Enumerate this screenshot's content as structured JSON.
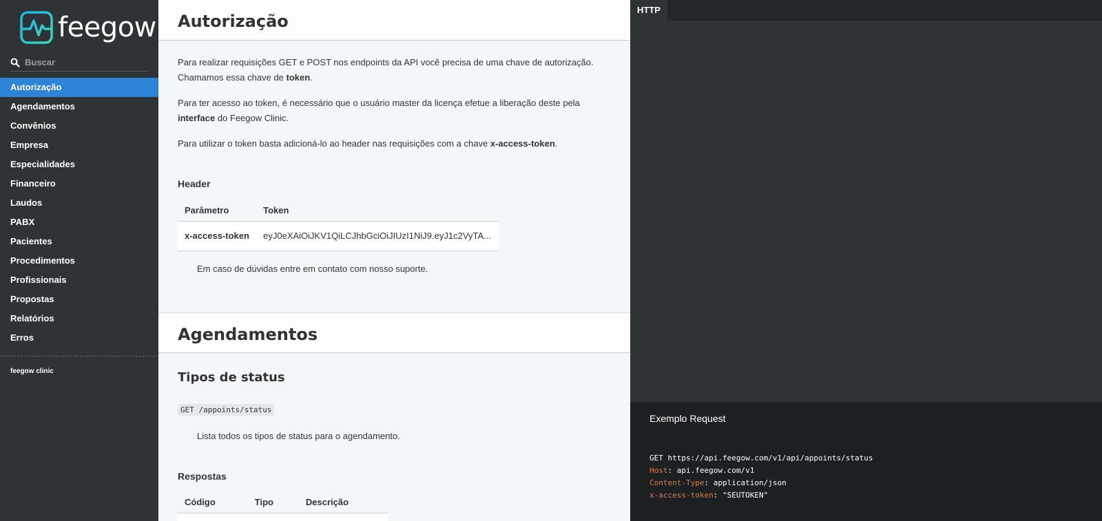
{
  "brand": {
    "name": "feegow",
    "accent": "#2c83d7",
    "logo_colors": [
      "#1fb5e8",
      "#3dd9b4"
    ]
  },
  "search": {
    "placeholder": "Buscar",
    "icon": "search-icon"
  },
  "sidebar": {
    "items": [
      {
        "label": "Autorização",
        "active": true
      },
      {
        "label": "Agendamentos"
      },
      {
        "label": "Convênios"
      },
      {
        "label": "Empresa"
      },
      {
        "label": "Especialidades"
      },
      {
        "label": "Financeiro"
      },
      {
        "label": "Laudos"
      },
      {
        "label": "PABX"
      },
      {
        "label": "Pacientes"
      },
      {
        "label": "Procedimentos"
      },
      {
        "label": "Profissionais"
      },
      {
        "label": "Propostas"
      },
      {
        "label": "Relatórios"
      },
      {
        "label": "Erros"
      }
    ],
    "footer": "feegow clinic"
  },
  "main": {
    "auth": {
      "title": "Autorização",
      "p1_a": "Para realizar requisições GET e POST nos endpoints da API você precisa de uma chave de autorização. Chamamos essa chave de ",
      "p1_b": "token",
      "p1_c": ".",
      "p2_a": "Para ter acesso ao token, é necessário que o usuário master da licença efetue a liberação deste pela ",
      "p2_b": "interface",
      "p2_c": " do Feegow Clinic.",
      "p3_a": "Para utilizar o token basta adicioná-lo ao header nas requisições com a chave ",
      "p3_b": "x-access-token",
      "p3_c": ".",
      "header_title": "Header",
      "table": {
        "headers": [
          "Parâmetro",
          "Token"
        ],
        "rows": [
          [
            "x-access-token",
            "eyJ0eXAiOiJKV1QiLCJhbGciOiJIUzI1NiJ9.eyJ1c2VyTA..."
          ]
        ]
      },
      "p4": "Em caso de dúvidas entre em contato com nosso suporte."
    },
    "agend": {
      "title": "Agendamentos",
      "subtitle": "Tipos de status",
      "endpoint": "GET /appoints/status",
      "desc": "Lista todos os tipos de status para o agendamento.",
      "resp_title": "Respostas",
      "table": {
        "headers": [
          "Código",
          "Tipo",
          "Descrição"
        ]
      }
    }
  },
  "codepanel": {
    "tab": "HTTP",
    "example_label": "Exemplo Request",
    "line1": "GET https://api.feegow.com/v1/api/appoints/status",
    "line2_key": "Host",
    "line2_val": ": api.feegow.com/v1",
    "line3_key": "Content-Type",
    "line3_val": ": application/json",
    "line4_key": "x-access-token",
    "line4_val": ": \"SEUTOKEN\""
  }
}
